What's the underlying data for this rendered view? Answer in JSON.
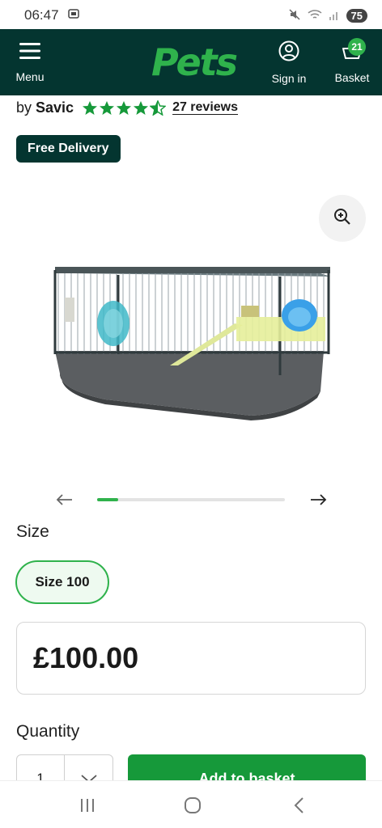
{
  "status_bar": {
    "time": "06:47",
    "battery": "75"
  },
  "header": {
    "logo": "Pets",
    "menu_label": "Menu",
    "signin_label": "Sign in",
    "basket_label": "Basket",
    "basket_count": "21"
  },
  "product": {
    "by": "by",
    "brand": "Savic",
    "rating": 4.5,
    "reviews_label": "27 reviews",
    "delivery_badge": "Free Delivery"
  },
  "carousel": {
    "progress": 0.11
  },
  "size": {
    "label": "Size",
    "selected": "Size 100"
  },
  "price": "£100.00",
  "quantity": {
    "label": "Quantity",
    "value": "1"
  },
  "add_to_basket_label": "Add to basket",
  "colors": {
    "header_bg": "#043530",
    "brand_green": "#2fb24c",
    "button_green": "#16993a"
  }
}
